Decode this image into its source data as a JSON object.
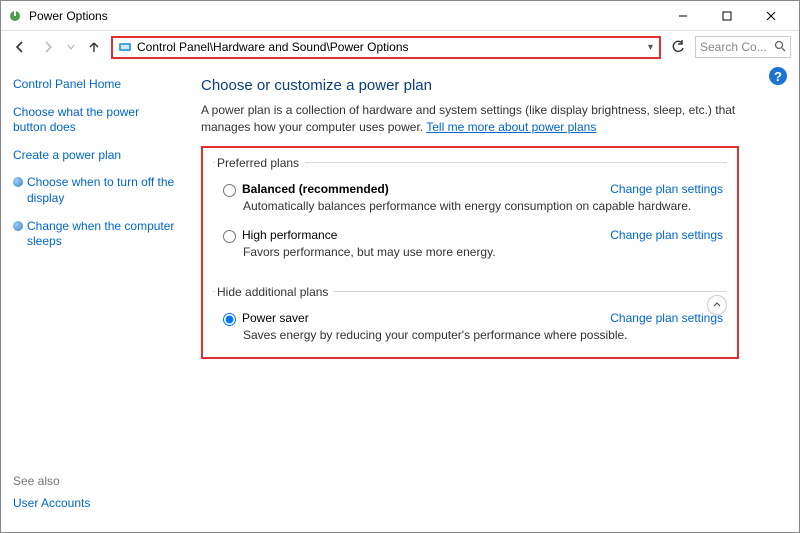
{
  "window": {
    "title": "Power Options"
  },
  "address": {
    "path": "Control Panel\\Hardware and Sound\\Power Options",
    "search_placeholder": "Search Co..."
  },
  "sidebar": {
    "items": [
      {
        "label": "Control Panel Home"
      },
      {
        "label": "Choose what the power button does"
      },
      {
        "label": "Create a power plan"
      },
      {
        "label": "Choose when to turn off the display"
      },
      {
        "label": "Change when the computer sleeps"
      }
    ],
    "see_also_heading": "See also",
    "see_also": [
      {
        "label": "User Accounts"
      }
    ]
  },
  "main": {
    "heading": "Choose or customize a power plan",
    "description_prefix": "A power plan is a collection of hardware and system settings (like display brightness, sleep, etc.) that manages how your computer uses power. ",
    "learn_more": "Tell me more about power plans",
    "preferred_legend": "Preferred plans",
    "hide_legend": "Hide additional plans",
    "change_label": "Change plan settings",
    "plans": {
      "balanced": {
        "name": "Balanced (recommended)",
        "desc": "Automatically balances performance with energy consumption on capable hardware."
      },
      "high": {
        "name": "High performance",
        "desc": "Favors performance, but may use more energy."
      },
      "saver": {
        "name": "Power saver",
        "desc": "Saves energy by reducing your computer's performance where possible."
      }
    }
  }
}
